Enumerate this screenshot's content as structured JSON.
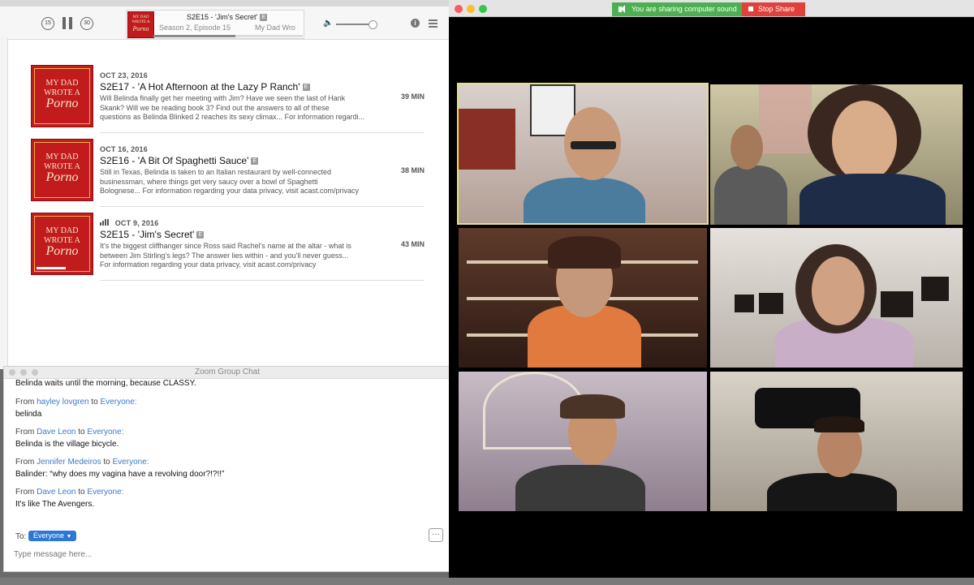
{
  "player": {
    "skip_back": "15",
    "skip_forward": "30",
    "now_playing_title": "S2E15 - 'Jim's Secret'",
    "now_playing_badge": "E",
    "now_playing_sub": "Season 2, Episode 15",
    "now_playing_show": "My Dad Wro",
    "progress": 0.55
  },
  "artwork_text": [
    "MY DAD",
    "WROTE A",
    "Porno"
  ],
  "episodes": [
    {
      "date": "OCT 23, 2016",
      "title": "S2E17 - 'A Hot Afternoon at the Lazy P Ranch'",
      "badge": "E",
      "desc_lines": [
        "Will Belinda finally get her meeting with Jim? Have we seen the last of Hank",
        "Skank? Will we be reading book 3? Find out the answers to all of these",
        "questions as Belinda Blinked 2 reaches its sexy climax...  For information regardi..."
      ],
      "duration": "39 MIN"
    },
    {
      "date": "OCT 16, 2016",
      "title": "S2E16 - 'A Bit Of Spaghetti Sauce'",
      "badge": "E",
      "desc_lines": [
        "Still in Texas, Belinda is taken to an Italian restaurant by well-connected",
        "businessman, where things get very saucy over a bowl of Spaghetti",
        "Bolognese...  For information regarding your data privacy, visit acast.com/privacy"
      ],
      "duration": "38 MIN"
    },
    {
      "date": "OCT 9, 2016",
      "title": "S2E15 - 'Jim's Secret'",
      "badge": "E",
      "desc_lines": [
        "It's the biggest cliffhanger since Ross said Rachel's name at the altar - what is",
        "between Jim Stirling's legs? The answer lies within - and you'll never guess...",
        "For information regarding your data privacy, visit acast.com/privacy"
      ],
      "duration": "43 MIN",
      "playing": true
    }
  ],
  "chat": {
    "window_title": "Zoom Group Chat",
    "first_line": "Belinda waits until the morning, because CLASSY.",
    "messages": [
      {
        "from_word": "From",
        "sender": "hayley lovgren",
        "to_word": "to",
        "recipient": "Everyone:",
        "text": "belinda"
      },
      {
        "from_word": "From",
        "sender": "Dave Leon",
        "to_word": "to",
        "recipient": "Everyone:",
        "text": "Belinda is the village bicycle."
      },
      {
        "from_word": "From",
        "sender": "Jennifer Medeiros",
        "to_word": "to",
        "recipient": "Everyone:",
        "text": "Balinder: “why does my vagina have a revolving door?!?!!”"
      },
      {
        "from_word": "From",
        "sender": "Dave Leon",
        "to_word": "to",
        "recipient": "Everyone:",
        "text": "It's like The Avengers."
      }
    ],
    "to_label": "To:",
    "to_value": "Everyone",
    "more_label": "···",
    "input_placeholder": "Type message here..."
  },
  "zoom": {
    "sharing_label": "You are sharing computer sound",
    "stop_share_label": "Stop Share"
  },
  "colors": {
    "artwork_red": "#c21b1e",
    "link_blue": "#3d7ac8",
    "share_green": "#4caf50",
    "stop_red": "#e0413a",
    "active_speaker": "#e8e07a"
  }
}
